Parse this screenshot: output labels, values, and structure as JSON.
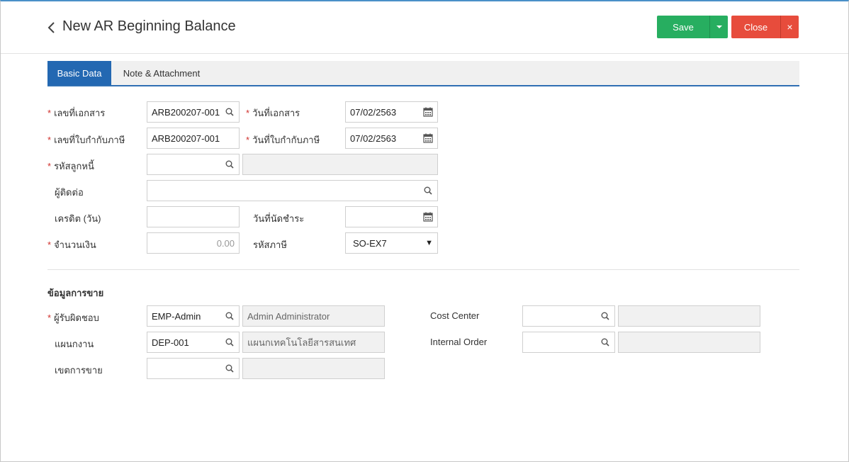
{
  "header": {
    "title": "New AR Beginning Balance",
    "save_label": "Save",
    "close_label": "Close",
    "close_x": "×"
  },
  "tabs": [
    {
      "label": "Basic Data",
      "active": true
    },
    {
      "label": "Note & Attachment",
      "active": false
    }
  ],
  "basic": {
    "doc_no": {
      "label": "เลขที่เอกสาร",
      "value": "ARB200207-001",
      "required": true
    },
    "doc_date": {
      "label": "วันที่เอกสาร",
      "value": "07/02/2563",
      "required": true
    },
    "tax_inv_no": {
      "label": "เลขที่ใบกำกับภาษี",
      "value": "ARB200207-001",
      "required": true
    },
    "tax_inv_date": {
      "label": "วันที่ใบกำกับภาษี",
      "value": "07/02/2563",
      "required": true
    },
    "debtor_code": {
      "label": "รหัสลูกหนี้",
      "value": "",
      "name_value": "",
      "required": true
    },
    "contact": {
      "label": "ผู้ติดต่อ",
      "value": ""
    },
    "credit_days": {
      "label": "เครดิต (วัน)",
      "value": ""
    },
    "due_date": {
      "label": "วันที่นัดชำระ",
      "value": ""
    },
    "amount": {
      "label": "จำนวนเงิน",
      "value": "0.00",
      "required": true
    },
    "tax_code": {
      "label": "รหัสภาษี",
      "value": "SO-EX7"
    }
  },
  "sales": {
    "section_title": "ข้อมูลการขาย",
    "responsible": {
      "label": "ผู้รับผิดชอบ",
      "value": "EMP-Admin",
      "name_value": "Admin Administrator",
      "required": true
    },
    "department": {
      "label": "แผนกงาน",
      "value": "DEP-001",
      "name_value": "แผนกเทคโนโลยีสารสนเทศ"
    },
    "sales_area": {
      "label": "เขตการขาย",
      "value": "",
      "name_value": ""
    },
    "cost_center": {
      "label": "Cost Center",
      "value": "",
      "name_value": ""
    },
    "internal_order": {
      "label": "Internal Order",
      "value": "",
      "name_value": ""
    }
  },
  "colors": {
    "save": "#27ae60",
    "close": "#e74c3c",
    "tab_active": "#2368b2",
    "required": "#d0312d"
  },
  "icons": {
    "search": "search-icon",
    "calendar": "calendar-icon",
    "back": "chevron-left-icon"
  }
}
